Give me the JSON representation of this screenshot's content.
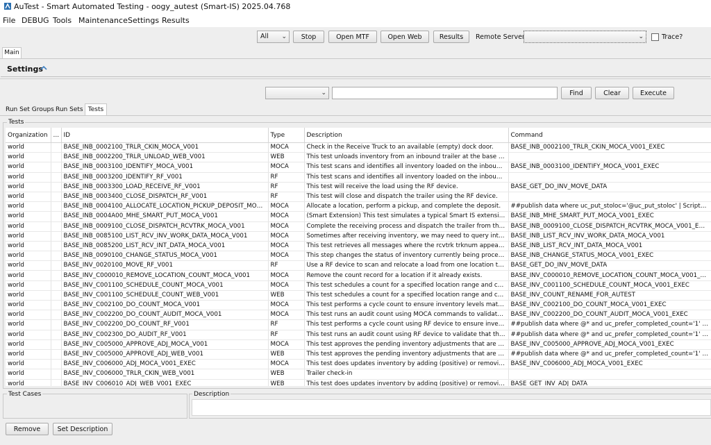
{
  "window": {
    "title": "AuTest - Smart Automated Testing - oogy_autest (Smart-IS) 2025.04.768"
  },
  "menu": [
    "File",
    "DEBUG",
    "Tools",
    "Maintenance",
    "Settings",
    "Results"
  ],
  "toolbar": {
    "filter_value": "All",
    "stop_label": "Stop",
    "open_mtf_label": "Open MTF",
    "open_web_label": "Open Web",
    "results_label": "Results",
    "remote_server_label": "Remote Server:",
    "remote_server_value": "",
    "trace_label": "Trace?",
    "trace_checked": false
  },
  "tabs": {
    "main": "Main"
  },
  "settings": {
    "title": "Settings"
  },
  "filter_row": {
    "combo_value": "",
    "search_value": "",
    "find_label": "Find",
    "clear_label": "Clear",
    "execute_label": "Execute"
  },
  "subtabs": [
    "Run Set Groups",
    "Run Sets",
    "Tests"
  ],
  "tests": {
    "legend": "Tests",
    "columns": [
      "Organization",
      "...",
      "ID",
      "Type",
      "Description",
      "Command"
    ],
    "rows": [
      [
        "world",
        "",
        "BASE_INB_0002100_TRLR_CKIN_MOCA_V001",
        "MOCA",
        "Check in the Receive Truck to an available (empty) dock door.",
        "BASE_INB_0002100_TRLR_CKIN_MOCA_V001_EXEC"
      ],
      [
        "world",
        "",
        "BASE_INB_0002200_TRLR_UNLOAD_WEB_V001",
        "WEB",
        "This test unloads inventory from an inbound trailer at the base war...",
        ""
      ],
      [
        "world",
        "",
        "BASE_INB_0003100_IDENTIFY_MOCA_V001",
        "MOCA",
        "This test scans and identifies all inventory loaded on the inbound tru...",
        "BASE_INB_0003100_IDENTIFY_MOCA_V001_EXEC"
      ],
      [
        "world",
        "",
        "BASE_INB_0003200_IDENTIFY_RF_V001",
        "RF",
        "This test scans and identifies all inventory loaded on the inbound tru...",
        ""
      ],
      [
        "world",
        "",
        "BASE_INB_0003300_LOAD_RECEIVE_RF_V001",
        "RF",
        "This test will receive the load using the RF device.",
        "BASE_GET_DO_INV_MOVE_DATA"
      ],
      [
        "world",
        "",
        "BASE_INB_0003400_CLOSE_DISPATCH_RF_V001",
        "RF",
        "This test will close and dispatch the trailer using the RF device.",
        ""
      ],
      [
        "world",
        "",
        "BASE_INB_0004100_ALLOCATE_LOCATION_PICKUP_DEPOSIT_MOCA_...",
        "MOCA",
        "Allocate a location, perform a pickup, and complete the deposit.",
        "##publish data where uc_put_stoloc='@uc_put_stoloc' | Script(\"BAS..."
      ],
      [
        "world",
        "",
        "BASE_INB_0004A00_MHE_SMART_PUT_MOCA_V001",
        "MOCA",
        "(Smart Extension) This test simulates a typical Smart IS extension u...",
        "BASE_INB_MHE_SMART_PUT_MOCA_V001_EXEC"
      ],
      [
        "world",
        "",
        "BASE_INB_0009100_CLOSE_DISPATCH_RCVTRK_MOCA_V001",
        "MOCA",
        "Complete the receiving process and dispatch the trailer from the dock.",
        "BASE_INB_0009100_CLOSE_DISPATCH_RCVTRK_MOCA_V001_EXEC"
      ],
      [
        "world",
        "",
        "BASE_INB_0085100_LIST_RCV_INV_WORK_DATA_MOCA_V001",
        "MOCA",
        "Sometimes after receiving inventory, we may need to query integra...",
        "BASE_INB_LIST_RCV_INV_WORK_DATA_MOCA_V001"
      ],
      [
        "world",
        "",
        "BASE_INB_0085200_LIST_RCV_INT_DATA_MOCA_V001",
        "MOCA",
        "This test retrieves all messages where the rcvtrk trknum appears in...",
        "BASE_INB_LIST_RCV_INT_DATA_MOCA_V001"
      ],
      [
        "world",
        "",
        "BASE_INB_0090100_CHANGE_STATUS_MOCA_V001",
        "MOCA",
        "This step changes the status of inventory currently being processed...",
        "BASE_INB_CHANGE_STATUS_MOCA_V001_EXEC"
      ],
      [
        "world",
        "",
        "BASE_INV_0020100_MOVE_RF_V001",
        "RF",
        "Use a RF device to scan and relocate a load from one location to an...",
        "BASE_GET_DO_INV_MOVE_DATA"
      ],
      [
        "world",
        "",
        "BASE_INV_C000010_REMOVE_LOCATION_COUNT_MOCA_V001",
        "MOCA",
        "Remove the count record for a location if it already exists.",
        "BASE_INV_C000010_REMOVE_LOCATION_COUNT_MOCA_V001_EXEC"
      ],
      [
        "world",
        "",
        "BASE_INV_C001100_SCHEDULE_COUNT_MOCA_V001",
        "MOCA",
        "This test schedules a count for a specified location range and creat...",
        "BASE_INV_C001100_SCHEDULE_COUNT_MOCA_V001_EXEC"
      ],
      [
        "world",
        "",
        "BASE_INV_C001100_SCHEDULE_COUNT_WEB_V001",
        "WEB",
        "This test schedules a count for a specified location range and creat...",
        "BASE_INV_COUNT_RENAME_FOR_AUTEST"
      ],
      [
        "world",
        "",
        "BASE_INV_C002100_DO_COUNT_MOCA_V001",
        "MOCA",
        "This test performs a cycle count to ensure inventory levels match th...",
        "BASE_INV_C002100_DO_COUNT_MOCA_V001_EXEC"
      ],
      [
        "world",
        "",
        "BASE_INV_C002200_DO_COUNT_AUDIT_MOCA_V001",
        "MOCA",
        "This test runs an audit count using MOCA commands to validate that...",
        "BASE_INV_C002200_DO_COUNT_AUDIT_MOCA_V001_EXEC"
      ],
      [
        "world",
        "",
        "BASE_INV_C002200_DO_COUNT_RF_V001",
        "RF",
        "This test performs a cycle count using RF device to ensure inventor...",
        "##publish data where @* and uc_prefer_completed_count='1' and ..."
      ],
      [
        "world",
        "",
        "BASE_INV_C002300_DO_AUDIT_RF_V001",
        "RF",
        "This test runs an audit count using RF device to validate that the rec...",
        "##publish data where @* and uc_prefer_completed_count='1' and ..."
      ],
      [
        "world",
        "",
        "BASE_INV_C005000_APPROVE_ADJ_MOCA_V001",
        "MOCA",
        "This test approves the pending inventory adjustments that are awai...",
        "BASE_INV_C005000_APPROVE_ADJ_MOCA_V001_EXEC"
      ],
      [
        "world",
        "",
        "BASE_INV_C005000_APPROVE_ADJ_WEB_V001",
        "WEB",
        "This test approves the pending inventory adjustments that are awai...",
        "##publish data where @* and uc_prefer_completed_count='1' and ..."
      ],
      [
        "world",
        "",
        "BASE_INV_C006000_ADJ_MOCA_V001_EXEC",
        "MOCA",
        "This test does updates inventory by adding (positive) or removing (...",
        "BASE_INV_C006000_ADJ_MOCA_V001_EXEC"
      ],
      [
        "world",
        "",
        "BASE_INV_C006000_TRLR_CKIN_WEB_V001",
        "WEB",
        "Trailer check-in",
        ""
      ],
      [
        "world",
        "",
        "BASE_INV_C006010_ADJ_WEB_V001_EXEC",
        "WEB",
        "This test does updates inventory by adding (positive) or removing (...",
        "BASE_GET_INV_ADJ_DATA"
      ]
    ]
  },
  "bottom": {
    "test_cases_label": "Test Cases",
    "description_label": "Description",
    "remove_label": "Remove",
    "set_description_label": "Set Description"
  }
}
